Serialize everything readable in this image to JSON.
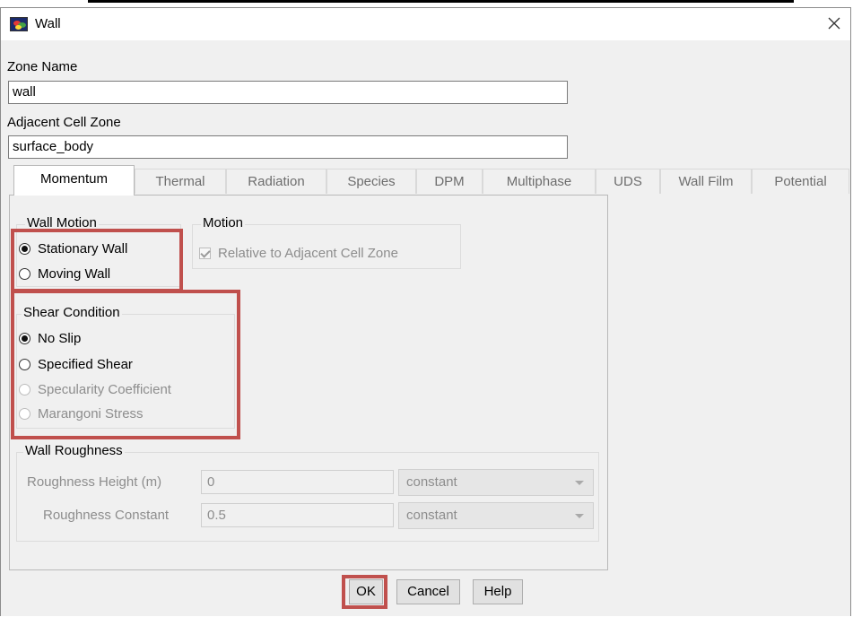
{
  "window": {
    "title": "Wall"
  },
  "zone_name": {
    "label": "Zone Name",
    "value": "wall"
  },
  "adjacent_cell_zone": {
    "label": "Adjacent Cell Zone",
    "value": "surface_body"
  },
  "tabs": [
    {
      "label": "Momentum",
      "active": true
    },
    {
      "label": "Thermal"
    },
    {
      "label": "Radiation"
    },
    {
      "label": "Species"
    },
    {
      "label": "DPM"
    },
    {
      "label": "Multiphase"
    },
    {
      "label": "UDS"
    },
    {
      "label": "Wall Film"
    },
    {
      "label": "Potential"
    }
  ],
  "wall_motion": {
    "label": "Wall Motion",
    "options": [
      {
        "label": "Stationary Wall",
        "selected": true
      },
      {
        "label": "Moving Wall",
        "selected": false
      }
    ]
  },
  "motion": {
    "label": "Motion",
    "checkbox_label": "Relative to Adjacent Cell Zone",
    "checked": true
  },
  "shear_condition": {
    "label": "Shear Condition",
    "options": [
      {
        "label": "No Slip",
        "selected": true
      },
      {
        "label": "Specified Shear",
        "selected": false
      },
      {
        "label": "Specularity Coefficient",
        "disabled": true
      },
      {
        "label": "Marangoni Stress",
        "disabled": true
      }
    ]
  },
  "wall_roughness": {
    "label": "Wall Roughness",
    "height": {
      "label": "Roughness Height (m)",
      "value": "0",
      "method": "constant"
    },
    "constant": {
      "label": "Roughness Constant",
      "value": "0.5",
      "method": "constant"
    }
  },
  "buttons": {
    "ok": "OK",
    "cancel": "Cancel",
    "help": "Help"
  },
  "colors": {
    "highlight": "#c0504d",
    "dialog_bg": "#f0f0f0"
  }
}
